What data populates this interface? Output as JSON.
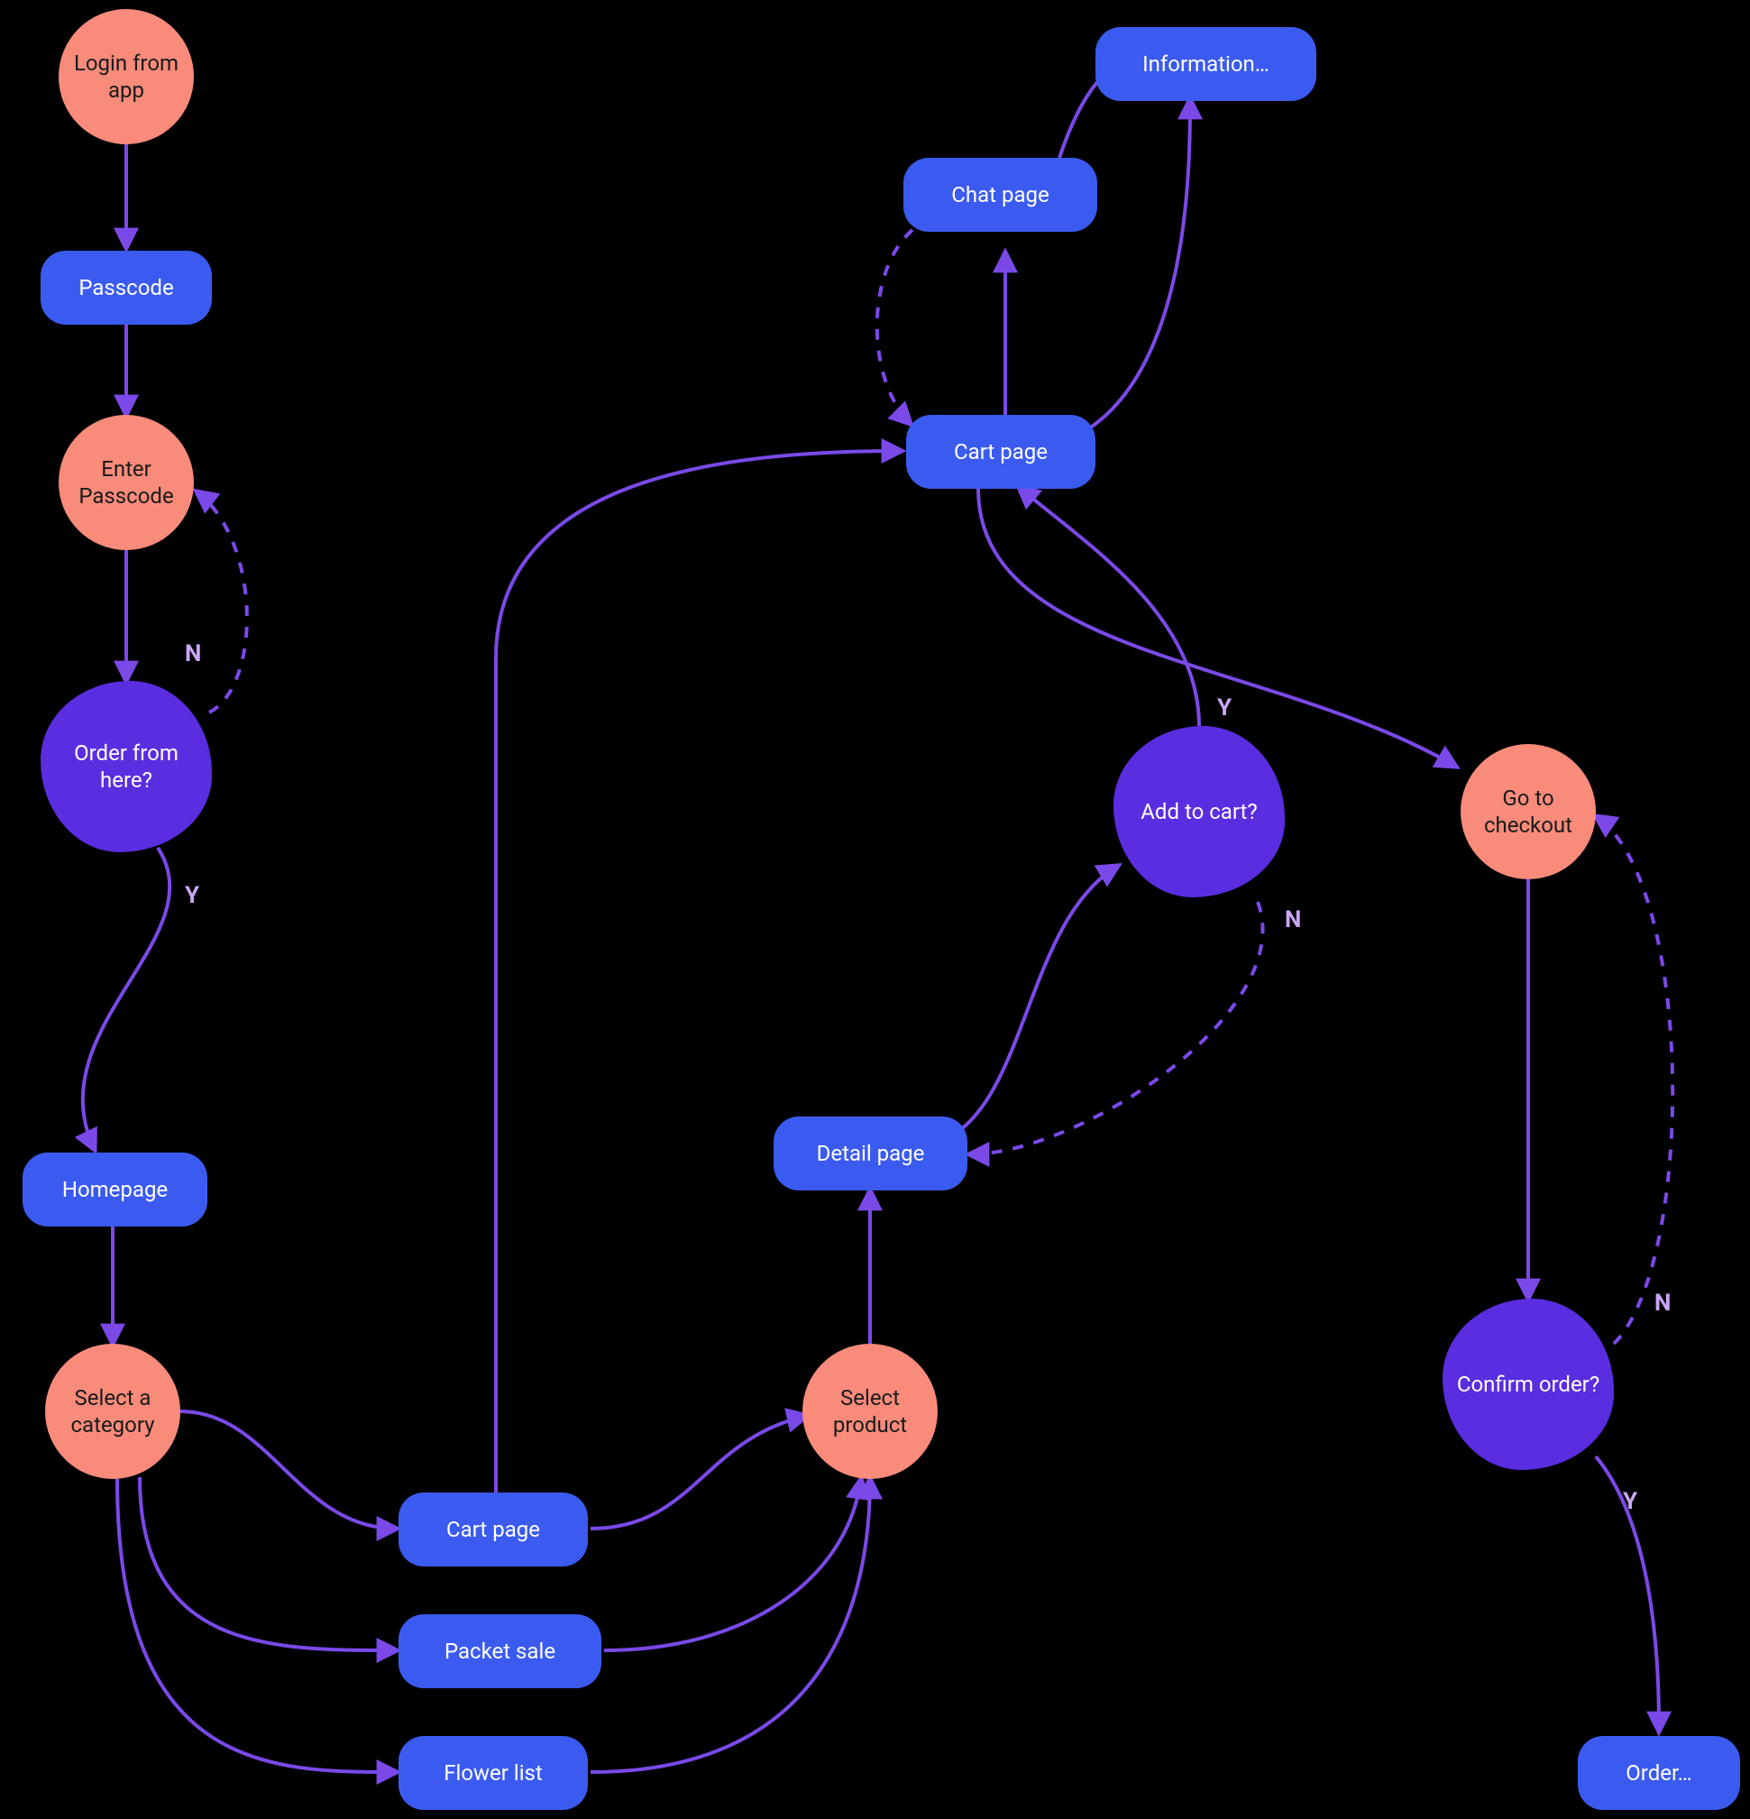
{
  "colors": {
    "circle": "#F98B7B",
    "pill": "#3B5BF0",
    "decision": "#5B2DE0",
    "edge": "#7B49E8",
    "edge_label": "#C9A6F5",
    "background": "#000000"
  },
  "nodes": {
    "login_from_app": {
      "type": "circle",
      "label": "Login from app"
    },
    "passcode": {
      "type": "pill",
      "label": "Passcode"
    },
    "enter_passcode": {
      "type": "circle",
      "label": "Enter Passcode"
    },
    "order_from_here": {
      "type": "decision",
      "label": "Order from here?"
    },
    "homepage": {
      "type": "pill",
      "label": "Homepage"
    },
    "select_category": {
      "type": "circle",
      "label": "Select a category"
    },
    "cart_page_lower": {
      "type": "pill",
      "label": "Cart page"
    },
    "packet_sale": {
      "type": "pill",
      "label": "Packet sale"
    },
    "flower_list": {
      "type": "pill",
      "label": "Flower list"
    },
    "select_product": {
      "type": "circle",
      "label": "Select product"
    },
    "detail_page": {
      "type": "pill",
      "label": "Detail page"
    },
    "add_to_cart": {
      "type": "decision",
      "label": "Add to cart?"
    },
    "cart_page_upper": {
      "type": "pill",
      "label": "Cart page"
    },
    "chat_page": {
      "type": "pill",
      "label": "Chat page"
    },
    "information": {
      "type": "pill",
      "label": "Information…"
    },
    "go_to_checkout": {
      "type": "circle",
      "label": "Go to checkout"
    },
    "confirm_order": {
      "type": "decision",
      "label": "Confirm order?"
    },
    "order_final": {
      "type": "pill",
      "label": "Order…"
    }
  },
  "edges": [
    {
      "from": "login_from_app",
      "to": "passcode",
      "style": "solid"
    },
    {
      "from": "passcode",
      "to": "enter_passcode",
      "style": "solid"
    },
    {
      "from": "enter_passcode",
      "to": "order_from_here",
      "style": "solid"
    },
    {
      "from": "order_from_here",
      "to": "enter_passcode",
      "style": "dashed",
      "label": "N"
    },
    {
      "from": "order_from_here",
      "to": "homepage",
      "style": "solid",
      "label": "Y"
    },
    {
      "from": "homepage",
      "to": "select_category",
      "style": "solid"
    },
    {
      "from": "select_category",
      "to": "cart_page_lower",
      "style": "solid"
    },
    {
      "from": "select_category",
      "to": "packet_sale",
      "style": "solid"
    },
    {
      "from": "select_category",
      "to": "flower_list",
      "style": "solid"
    },
    {
      "from": "cart_page_lower",
      "to": "select_product",
      "style": "solid"
    },
    {
      "from": "packet_sale",
      "to": "select_product",
      "style": "solid"
    },
    {
      "from": "flower_list",
      "to": "select_product",
      "style": "solid"
    },
    {
      "from": "select_product",
      "to": "detail_page",
      "style": "solid"
    },
    {
      "from": "detail_page",
      "to": "add_to_cart",
      "style": "solid"
    },
    {
      "from": "add_to_cart",
      "to": "cart_page_upper",
      "style": "solid",
      "label": "Y"
    },
    {
      "from": "add_to_cart",
      "to": "detail_page",
      "style": "dashed",
      "label": "N"
    },
    {
      "from": "cart_page_upper",
      "to": "chat_page",
      "style": "solid"
    },
    {
      "from": "cart_page_upper",
      "to": "information",
      "style": "solid"
    },
    {
      "from": "chat_page",
      "to": "information",
      "style": "solid"
    },
    {
      "from": "chat_page",
      "to": "cart_page_upper",
      "style": "dashed"
    },
    {
      "from": "cart_page_upper",
      "to": "go_to_checkout",
      "style": "solid"
    },
    {
      "from": "go_to_checkout",
      "to": "confirm_order",
      "style": "solid"
    },
    {
      "from": "confirm_order",
      "to": "go_to_checkout",
      "style": "dashed",
      "label": "N"
    },
    {
      "from": "confirm_order",
      "to": "order_final",
      "style": "solid",
      "label": "Y"
    }
  ],
  "edge_labels": {
    "order_from_here_N": "N",
    "order_from_here_Y": "Y",
    "add_to_cart_Y": "Y",
    "add_to_cart_N": "N",
    "confirm_order_N": "N",
    "confirm_order_Y": "Y"
  }
}
